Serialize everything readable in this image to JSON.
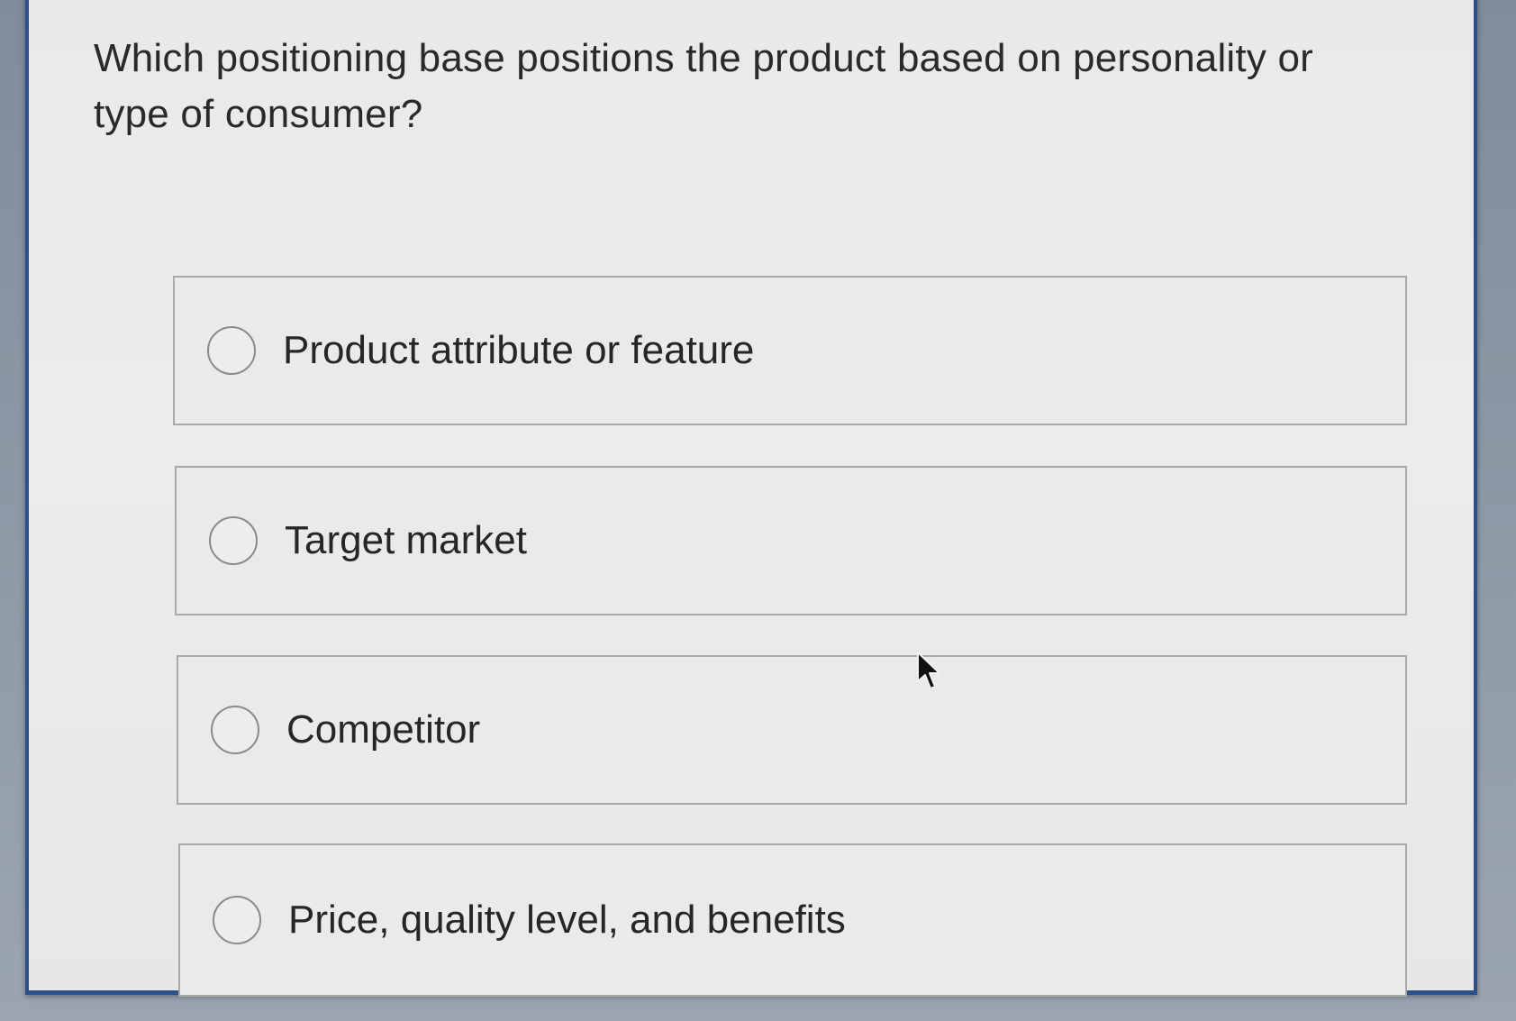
{
  "question": {
    "text": "Which positioning base positions the product based on personality or type of consumer?"
  },
  "options": [
    {
      "label": "Product attribute or feature",
      "selected": false
    },
    {
      "label": "Target market",
      "selected": false
    },
    {
      "label": "Competitor",
      "selected": false
    },
    {
      "label": "Price, quality level, and benefits",
      "selected": false
    }
  ],
  "colors": {
    "panel_border": "#2d4f8a",
    "panel_background": "#e9e9e8",
    "option_border": "#a9a9a7",
    "text": "#262626"
  },
  "icons": {
    "radio": "radio-unchecked-icon",
    "cursor": "mouse-pointer-icon"
  }
}
